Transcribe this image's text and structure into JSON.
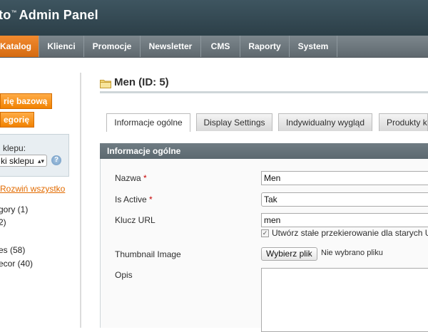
{
  "header": {
    "logo_prefix": "to",
    "logo_tm": "™",
    "logo_text": "Admin Panel"
  },
  "nav": {
    "items": [
      {
        "label": "Katalog",
        "active": true
      },
      {
        "label": "Klienci"
      },
      {
        "label": "Promocje"
      },
      {
        "label": "Newsletter"
      },
      {
        "label": "CMS"
      },
      {
        "label": "Raporty"
      },
      {
        "label": "System"
      }
    ]
  },
  "sidebar": {
    "add_root_category_button": "rię bazową",
    "add_subcategory_button": "egorię",
    "store_label": "klepu:",
    "store_select_value": "ki sklepu",
    "help_icon_glyph": "?",
    "expand_all_link": "Rozwiń wszystko",
    "tree": [
      {
        "label": "gory (1)"
      },
      {
        "label": "2)"
      },
      {
        "label": "es (58)"
      },
      {
        "label": "ecor (40)"
      }
    ]
  },
  "main": {
    "title": "Men (ID: 5)",
    "tabs": [
      {
        "label": "Informacje ogólne",
        "active": true
      },
      {
        "label": "Display Settings"
      },
      {
        "label": "Indywidualny wygląd"
      },
      {
        "label": "Produkty ka"
      }
    ],
    "section_title": "Informacje ogólne",
    "fields": {
      "name_label": "Nazwa",
      "name_value": "Men",
      "active_label": "Is Active",
      "active_value": "Tak",
      "url_key_label": "Klucz URL",
      "url_key_value": "men",
      "redirect_checkbox_label": "Utwórz stałe przekierowanie dla starych U",
      "thumbnail_label": "Thumbnail Image",
      "file_button_label": "Wybierz plik",
      "file_status": "Nie wybrano pliku",
      "description_label": "Opis",
      "required_marker": "*"
    }
  },
  "colors": {
    "accent_orange": "#eb5e00",
    "header_dark": "#2c3f48",
    "nav_gray": "#6b757b",
    "section_header": "#66737a"
  }
}
